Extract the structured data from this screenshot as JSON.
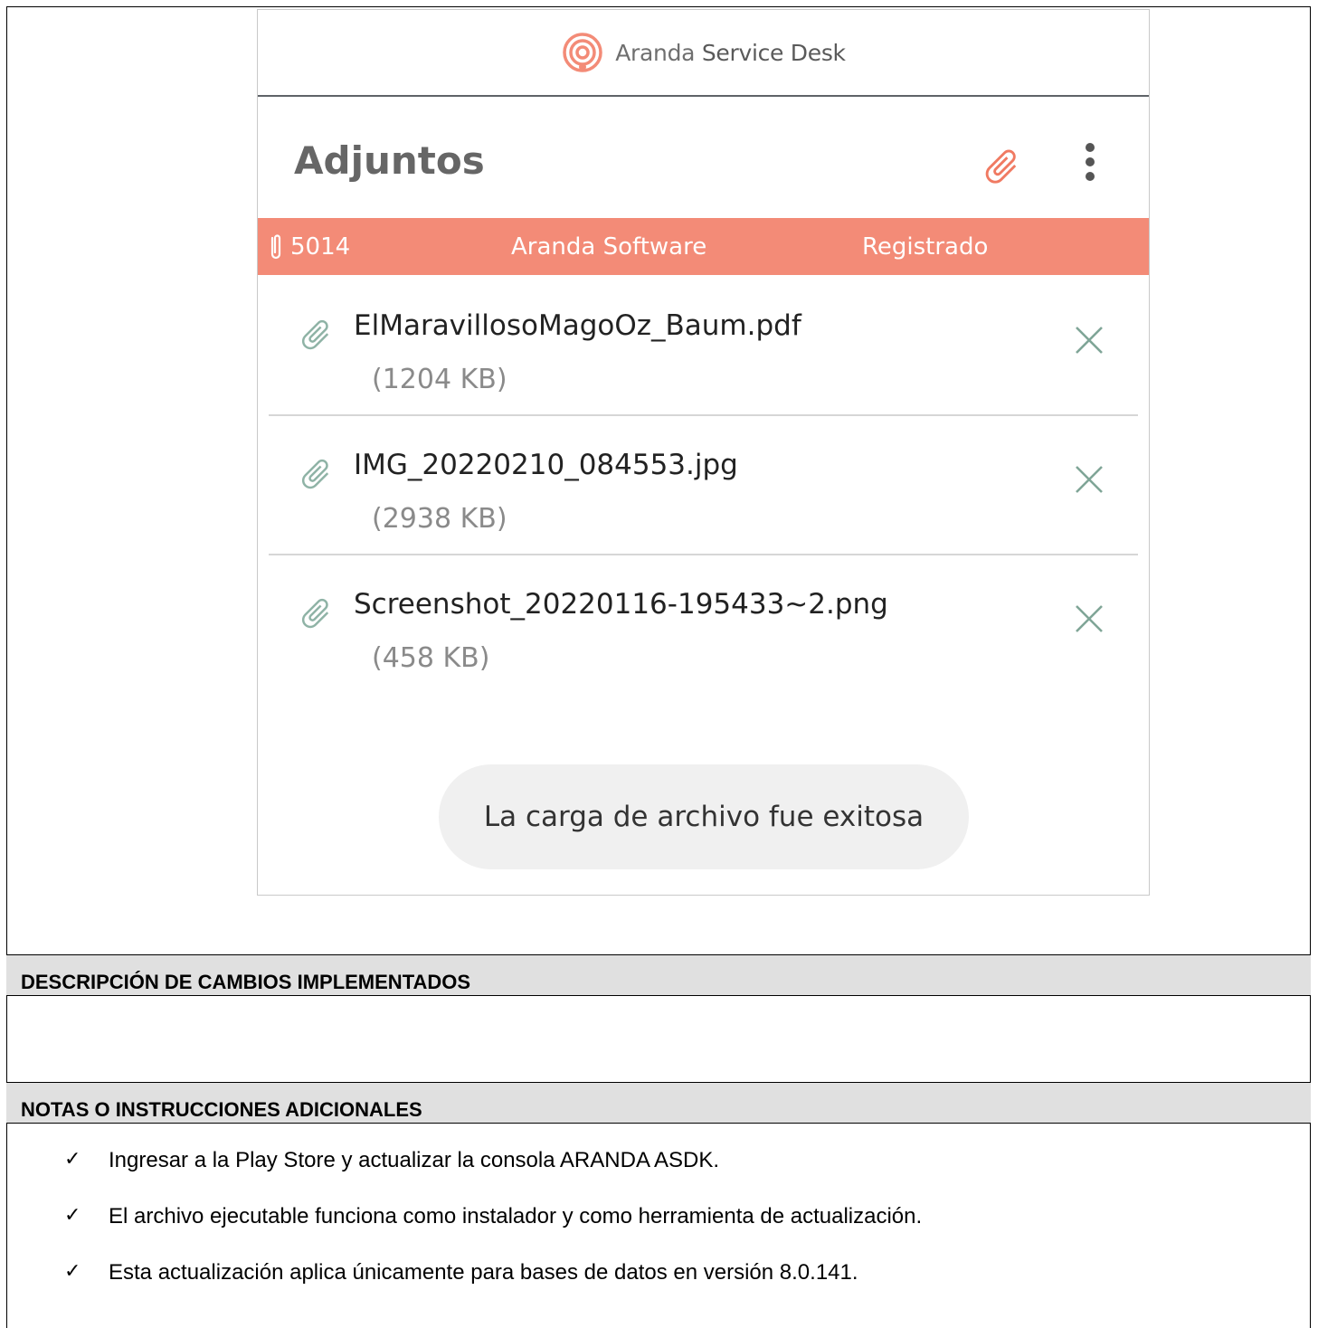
{
  "app": {
    "brand": "Aranda Service Desk",
    "brand_word1": "Aranda",
    "brand_word2": "Service Desk",
    "title": "Adjuntos",
    "accent_color": "#f38b77"
  },
  "case_bar": {
    "id": "5014",
    "company": "Aranda Software",
    "status": "Registrado"
  },
  "attachments": [
    {
      "name": "ElMaravillosoMagoOz_Baum.pdf",
      "size": "(1204 KB)"
    },
    {
      "name": "IMG_20220210_084553.jpg",
      "size": "(2938 KB)"
    },
    {
      "name": "Screenshot_20220116-195433~2.png",
      "size": "(458 KB)"
    }
  ],
  "toast": "La carga de archivo fue exitosa",
  "sections": {
    "changes_title": "DESCRIPCIÓN DE CAMBIOS IMPLEMENTADOS",
    "notes_title": "NOTAS O INSTRUCCIONES ADICIONALES"
  },
  "notes": [
    "Ingresar a la Play Store y actualizar la consola ARANDA ASDK.",
    "El archivo ejecutable funciona como instalador y como herramienta de actualización.",
    "Esta actualización aplica únicamente para bases de datos en versión 8.0.141."
  ],
  "icons": {
    "logo": "aranda-logo-icon",
    "attach": "paperclip-icon",
    "more": "more-vert-icon",
    "close": "close-icon",
    "check": "check-icon"
  }
}
